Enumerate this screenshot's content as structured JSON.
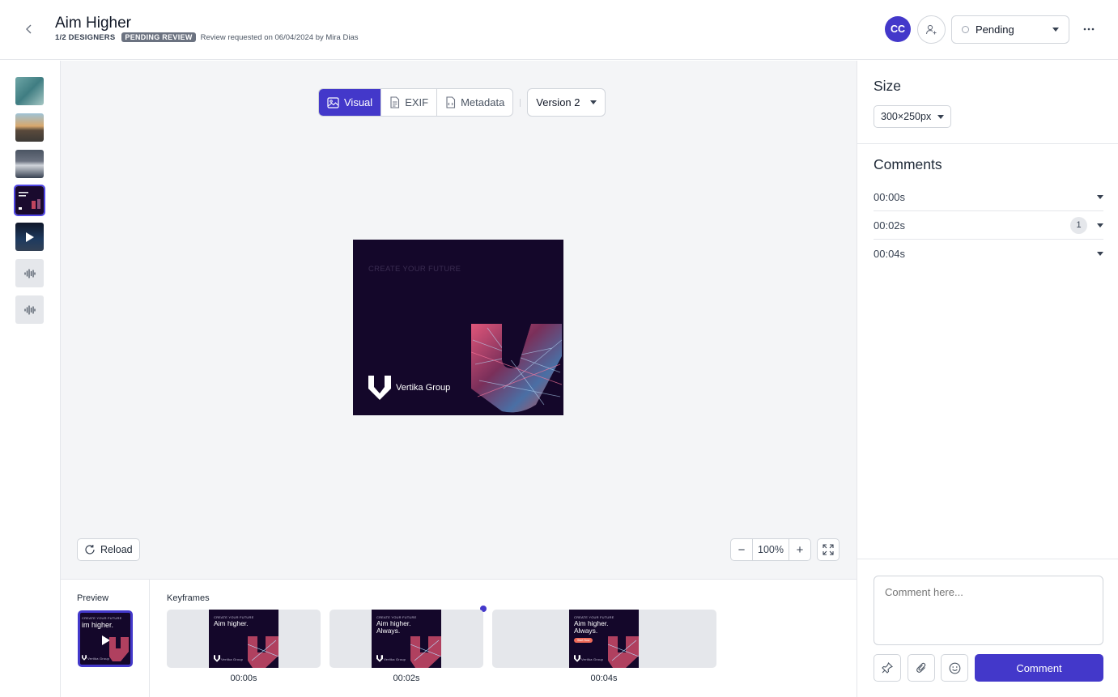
{
  "header": {
    "title": "Aim Higher",
    "designers": "1/2 DESIGNERS",
    "status_badge": "PENDING REVIEW",
    "request_info": "Review requested on 06/04/2024 by Mira Dias",
    "avatar_initials": "CC",
    "status_value": "Pending"
  },
  "toolbar": {
    "tabs": [
      {
        "label": "Visual",
        "icon": "image-icon",
        "active": true
      },
      {
        "label": "EXIF",
        "icon": "document-icon",
        "active": false
      },
      {
        "label": "Metadata",
        "icon": "code-file-icon",
        "active": false
      }
    ],
    "version": "Version 2"
  },
  "banner": {
    "tagline": "CREATE YOUR FUTURE",
    "brand": "Vertika Group"
  },
  "canvas_controls": {
    "reload_label": "Reload",
    "zoom": "100%",
    "zoom_out": "−",
    "zoom_in": "+"
  },
  "bottom": {
    "preview_label": "Preview",
    "keyframes_label": "Keyframes",
    "preview_headline": "im higher.",
    "keyframes": [
      {
        "time": "00:00s",
        "tag": "CREATE YOUR FUTURE",
        "headline": "Aim higher.",
        "cta": "",
        "brand": "Vertika Group"
      },
      {
        "time": "00:02s",
        "tag": "CREATE YOUR FUTURE",
        "headline": "Aim higher. Always.",
        "cta": "",
        "brand": "Vertika Group"
      },
      {
        "time": "00:04s",
        "tag": "CREATE YOUR FUTURE",
        "headline": "Aim higher. Always.",
        "cta": "Start Now",
        "brand": "Vertika Group"
      }
    ]
  },
  "sidebar_right": {
    "size_heading": "Size",
    "size_value": "300×250px",
    "comments_heading": "Comments",
    "comment_groups": [
      {
        "time": "00:00s",
        "count": ""
      },
      {
        "time": "00:02s",
        "count": "1"
      },
      {
        "time": "00:04s",
        "count": ""
      }
    ],
    "comment_placeholder": "Comment here...",
    "comment_button": "Comment"
  },
  "colors": {
    "accent": "#4338ca",
    "banner_bg": "#14072a",
    "canvas_bg": "#f4f5f7"
  }
}
